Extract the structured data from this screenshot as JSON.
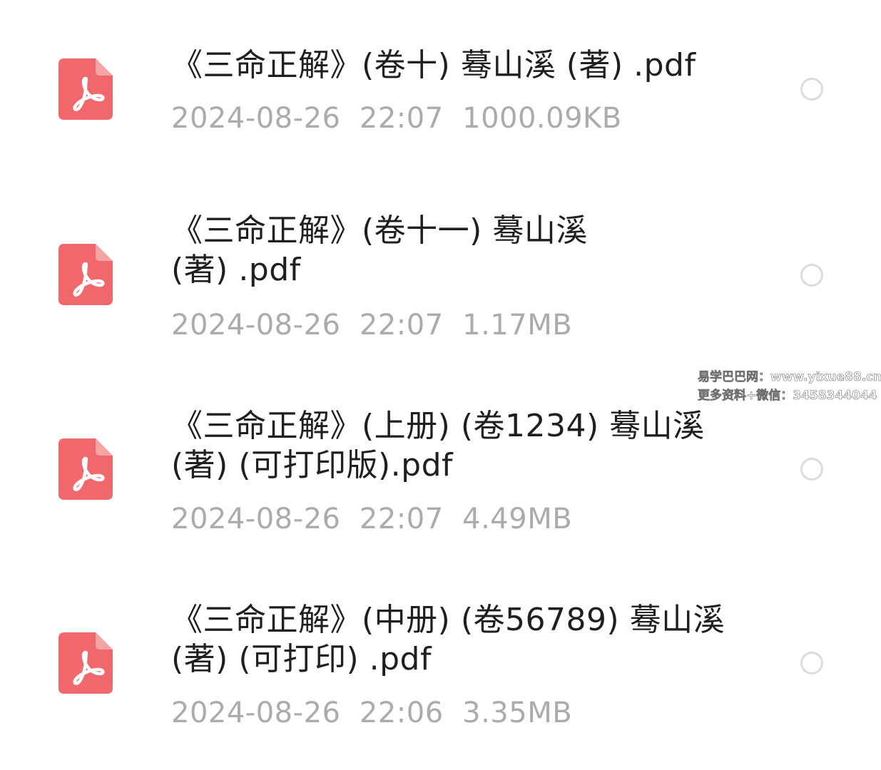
{
  "files": [
    {
      "name": "《三命正解》(卷十) 蓦山溪 (著) .pdf",
      "date": "2024-08-26",
      "time": "22:07",
      "size": "1000.09KB",
      "icon": "pdf-icon"
    },
    {
      "name": "《三命正解》(卷十一) 蓦山溪 (著) .pdf",
      "date": "2024-08-26",
      "time": "22:07",
      "size": "1.17MB",
      "icon": "pdf-icon"
    },
    {
      "name": "《三命正解》(上册) (卷1234) 蓦山溪 (著) (可打印版).pdf",
      "date": "2024-08-26",
      "time": "22:07",
      "size": "4.49MB",
      "icon": "pdf-icon"
    },
    {
      "name": "《三命正解》(中册) (卷56789) 蓦山溪 (著) (可打印) .pdf",
      "date": "2024-08-26",
      "time": "22:06",
      "size": "3.35MB",
      "icon": "pdf-icon"
    }
  ],
  "watermark": {
    "line1": "易学巴巴网：www.yixue88.cn",
    "line2": "更多资料+微信：3458344044"
  },
  "colors": {
    "icon_bg": "#f0686c",
    "name_text": "#1f1f1f",
    "meta_text": "#a9abae",
    "radio_border": "#dcdcdc"
  }
}
